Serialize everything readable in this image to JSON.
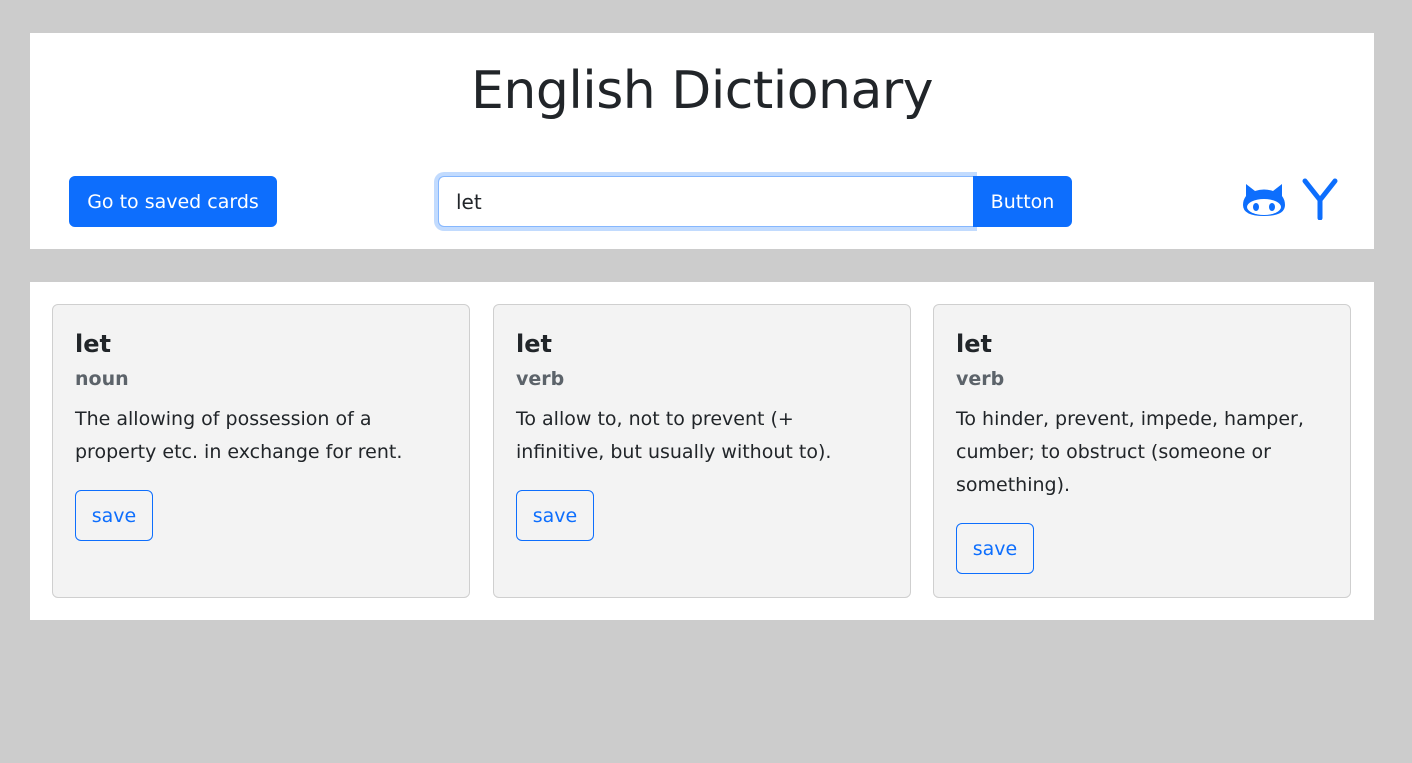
{
  "header": {
    "title": "English Dictionary",
    "saved_cards_label": "Go to saved cards",
    "search": {
      "value": "let",
      "button_label": "Button"
    },
    "icons": [
      "github-icon",
      "y-icon"
    ]
  },
  "colors": {
    "primary": "#0d6efd",
    "page_bg": "#cccccc",
    "card_bg": "#f3f3f3"
  },
  "cards": [
    {
      "word": "let",
      "part_of_speech": "noun",
      "definition": "The allowing of possession of a property etc. in exchange for rent.",
      "save_label": "save"
    },
    {
      "word": "let",
      "part_of_speech": "verb",
      "definition": "To allow to, not to prevent (+ infinitive, but usually without to).",
      "save_label": "save"
    },
    {
      "word": "let",
      "part_of_speech": "verb",
      "definition": "To hinder, prevent, impede, hamper, cumber; to obstruct (someone or something).",
      "save_label": "save"
    }
  ]
}
